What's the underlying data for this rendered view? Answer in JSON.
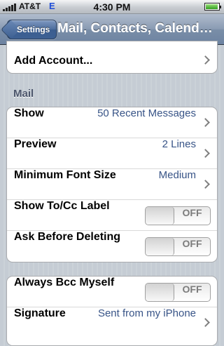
{
  "status_bar": {
    "carrier": "AT&T",
    "network": "E",
    "time": "4:30 PM"
  },
  "nav": {
    "back_label": "Settings",
    "title": "Mail, Contacts, Calend…"
  },
  "accounts": {
    "add_account_label": "Add Account..."
  },
  "mail_section": {
    "header": "Mail",
    "rows": [
      {
        "label": "Show",
        "value": "50 Recent Messages"
      },
      {
        "label": "Preview",
        "value": "2 Lines"
      },
      {
        "label": "Minimum Font Size",
        "value": "Medium"
      }
    ],
    "toggles": [
      {
        "label": "Show To/Cc Label",
        "state": "OFF"
      },
      {
        "label": "Ask Before Deleting",
        "state": "OFF"
      }
    ]
  },
  "compose_section": {
    "bcc_label": "Always Bcc Myself",
    "bcc_state": "OFF",
    "signature_label": "Signature",
    "signature_value": "Sent from my iPhone"
  },
  "colors": {
    "value_text": "#385487",
    "nav_bar": "#6d83a1",
    "background": "#c5ccd4"
  }
}
